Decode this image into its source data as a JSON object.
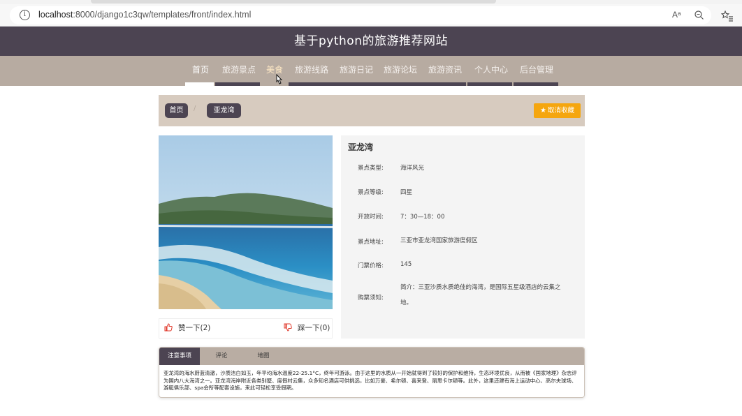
{
  "browser": {
    "url_host": "localhost",
    "url_rest": ":8000/django1c3qw/templates/front/index.html",
    "read_aloud_label": "Aᵃ"
  },
  "site": {
    "title": "基于python的旅游推荐网站"
  },
  "nav": {
    "items": [
      {
        "label": "首页",
        "state": "active"
      },
      {
        "label": "旅游景点",
        "state": "normal"
      },
      {
        "label": "美食",
        "state": "hover"
      },
      {
        "label": "旅游线路",
        "state": "normal"
      },
      {
        "label": "旅游日记",
        "state": "normal"
      },
      {
        "label": "旅游论坛",
        "state": "normal"
      },
      {
        "label": "旅游资讯",
        "state": "normal"
      },
      {
        "label": "个人中心",
        "state": "normal"
      },
      {
        "label": "后台管理",
        "state": "normal"
      }
    ]
  },
  "breadcrumb": {
    "home": "首页",
    "separator": "/",
    "current": "亚龙湾"
  },
  "favorite_button": {
    "icon": "star-icon",
    "label": "取消收藏"
  },
  "spot": {
    "name": "亚龙湾",
    "fields": [
      {
        "label": "景点类型:",
        "value": "海洋风光"
      },
      {
        "label": "景点等级:",
        "value": "四星"
      },
      {
        "label": "开放时间:",
        "value": "7：30—18：00"
      },
      {
        "label": "景点地址:",
        "value": "三亚市亚龙湾国家旅游度假区"
      },
      {
        "label": "门票价格:",
        "value": "145"
      },
      {
        "label": "购票须知:",
        "value": "简介：三亚沙质水质绝佳的海湾，是国际五星级酒店的云集之地。"
      }
    ]
  },
  "reactions": {
    "like_label": "赞一下(2)",
    "dislike_label": "踩一下(0)"
  },
  "tabs": {
    "items": [
      "注意事项",
      "评论",
      "地图"
    ],
    "active_index": 0,
    "content": "亚龙湾的海水蔚蓝清澈，沙质洁白如玉，年平均海水温度22-25.1°C，终年可游泳。由于这里的水质从一开始就得到了较好的保护和维持，生态环境优良，从而被《国家地理》杂志评为国内八大海湾之一。亚龙湾海岸附近各类别墅、度假村云集，众多知名酒店可供挑选，比如万豪、希尔顿、喜来登、丽思卡尔顿等。此外，这里还建有海上运动中心、高尔夫球场、游艇俱乐部、spa会所等配套设施，来此可轻松享受假期。"
  },
  "colors": {
    "header_bg": "#4c4452",
    "nav_bg": "#b7aba1",
    "crumb_bg": "#d7cbbf",
    "favorite_bg": "#f5a60f",
    "thumb_color": "#e0392b"
  }
}
